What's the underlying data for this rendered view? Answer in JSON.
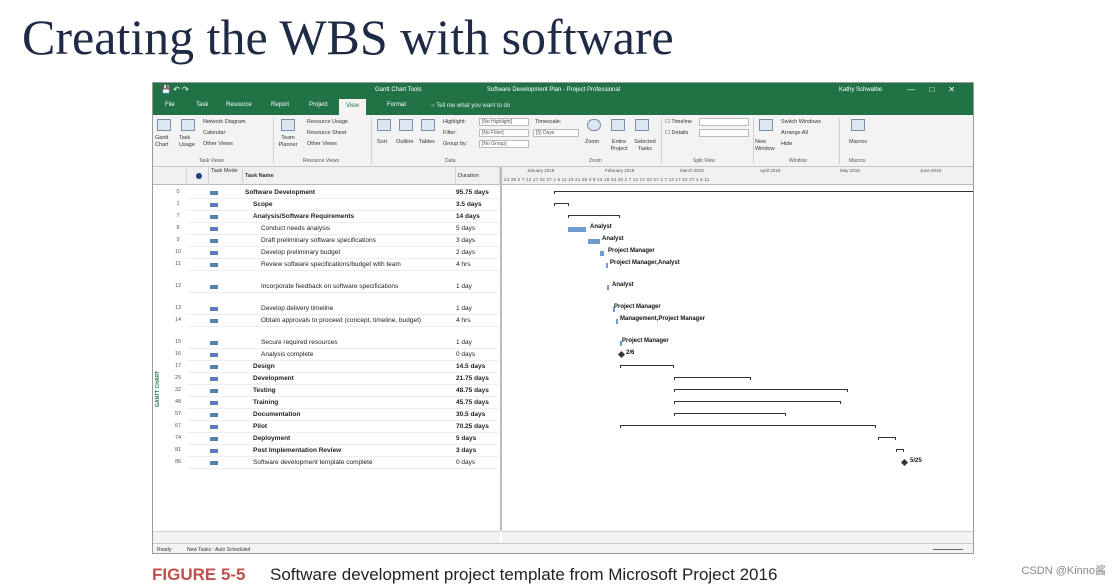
{
  "slide_title": "Creating the WBS with software",
  "window": {
    "contextual_tab": "Gantt Chart Tools",
    "title": "Software Development Plan - Project Professional",
    "user": "Kathy Schwalbe"
  },
  "tabs": [
    "File",
    "Task",
    "Resource",
    "Report",
    "Project",
    "View",
    "Format"
  ],
  "active_tab": "View",
  "tell_me": "Tell me what you want to do",
  "ribbon": {
    "gantt_chart": "Gantt Chart",
    "task_usage": "Task Usage",
    "network_diagram": "Network Diagram",
    "calendar": "Calendar",
    "other_views_1": "Other Views",
    "team_planner": "Team Planner",
    "resource_usage": "Resource Usage",
    "resource_sheet": "Resource Sheet",
    "other_views_2": "Other Views",
    "sort": "Sort",
    "outline": "Outline",
    "tables": "Tables",
    "highlight_label": "Highlight:",
    "highlight_value": "[No Highlight]",
    "filter_label": "Filter:",
    "filter_value": "[No Filter]",
    "group_label": "Group by:",
    "group_value": "[No Group]",
    "timescale_label": "Timescale:",
    "timescale_value": "[5] Days",
    "zoom": "Zoom",
    "entire_project": "Entire Project",
    "selected_tasks": "Selected Tasks",
    "timeline": "Timeline",
    "details": "Details",
    "new_window": "New Window",
    "switch_windows": "Switch Windows",
    "arrange_all": "Arrange All",
    "hide": "Hide",
    "macros": "Macros",
    "group_task_views": "Task Views",
    "group_resource_views": "Resource Views",
    "group_data": "Data",
    "group_zoom": "Zoom",
    "group_split_view": "Split View",
    "group_window": "Window",
    "group_macros": "Macros"
  },
  "columns": {
    "mode": "Task Mode",
    "name": "Task Name",
    "duration": "Duration"
  },
  "side_label": "GANTT CHART",
  "rows": [
    {
      "id": "0",
      "name": "Software Development",
      "duration": "95.75 days",
      "bold": true,
      "indent": 0
    },
    {
      "id": "1",
      "name": "Scope",
      "duration": "3.5 days",
      "bold": true,
      "indent": 1
    },
    {
      "id": "7",
      "name": "Analysis/Software Requirements",
      "duration": "14 days",
      "bold": true,
      "indent": 1
    },
    {
      "id": "8",
      "name": "Conduct needs analysis",
      "duration": "5 days",
      "bold": false,
      "indent": 2
    },
    {
      "id": "9",
      "name": "Draft preliminary software specifications",
      "duration": "3 days",
      "bold": false,
      "indent": 2
    },
    {
      "id": "10",
      "name": "Develop preliminary budget",
      "duration": "2 days",
      "bold": false,
      "indent": 2
    },
    {
      "id": "11",
      "name": "Review software specifications/budget with team",
      "duration": "4 hrs",
      "bold": false,
      "indent": 2
    },
    {
      "id": "12",
      "name": "Incorporate feedback on software specifications",
      "duration": "1 day",
      "bold": false,
      "indent": 2
    },
    {
      "id": "13",
      "name": "Develop delivery timeline",
      "duration": "1 day",
      "bold": false,
      "indent": 2
    },
    {
      "id": "14",
      "name": "Obtain approvals to proceed (concept, timeline, budget)",
      "duration": "4 hrs",
      "bold": false,
      "indent": 2
    },
    {
      "id": "15",
      "name": "Secure required resources",
      "duration": "1 day",
      "bold": false,
      "indent": 2
    },
    {
      "id": "16",
      "name": "Analysis complete",
      "duration": "0 days",
      "bold": false,
      "indent": 2
    },
    {
      "id": "17",
      "name": "Design",
      "duration": "14.5 days",
      "bold": true,
      "indent": 1
    },
    {
      "id": "25",
      "name": "Development",
      "duration": "21.75 days",
      "bold": true,
      "indent": 1
    },
    {
      "id": "32",
      "name": "Testing",
      "duration": "48.75 days",
      "bold": true,
      "indent": 1
    },
    {
      "id": "48",
      "name": "Training",
      "duration": "45.75 days",
      "bold": true,
      "indent": 1
    },
    {
      "id": "57",
      "name": "Documentation",
      "duration": "30.5 days",
      "bold": true,
      "indent": 1
    },
    {
      "id": "67",
      "name": "Pilot",
      "duration": "70.25 days",
      "bold": true,
      "indent": 1
    },
    {
      "id": "74",
      "name": "Deployment",
      "duration": "5 days",
      "bold": true,
      "indent": 1
    },
    {
      "id": "81",
      "name": "Post Implementation Review",
      "duration": "3 days",
      "bold": true,
      "indent": 1
    },
    {
      "id": "86",
      "name": "Software development template complete",
      "duration": "0 days",
      "bold": false,
      "indent": 1
    }
  ],
  "timescale": {
    "months": [
      "January 2018",
      "February 2018",
      "March 2018",
      "April 2018",
      "May 2018",
      "June 2018"
    ],
    "days": "23 28 2 7 12 17 22 27 1 6 11 16 21 26 3 8 13 18 23 28 2 7 12 17 22 27 2 7 12 17 22 27 1 6 11"
  },
  "gantt_labels": [
    {
      "row": 3,
      "text": "Analyst"
    },
    {
      "row": 4,
      "text": "Analyst"
    },
    {
      "row": 5,
      "text": "Project Manager"
    },
    {
      "row": 6,
      "text": "Project Manager,Analyst"
    },
    {
      "row": 7,
      "text": "Analyst"
    },
    {
      "row": 8,
      "text": "Project Manager"
    },
    {
      "row": 9,
      "text": "Management,Project Manager"
    },
    {
      "row": 10,
      "text": "Project Manager"
    },
    {
      "row": 11,
      "text": "2/6"
    },
    {
      "row": 20,
      "text": "5/25"
    }
  ],
  "status": {
    "ready": "Ready",
    "new_tasks": "New Tasks : Auto Scheduled"
  },
  "caption": {
    "figure": "FIGURE 5-5",
    "text": "Software development project template from Microsoft Project 2016"
  },
  "watermark": "CSDN @Kinno酱"
}
